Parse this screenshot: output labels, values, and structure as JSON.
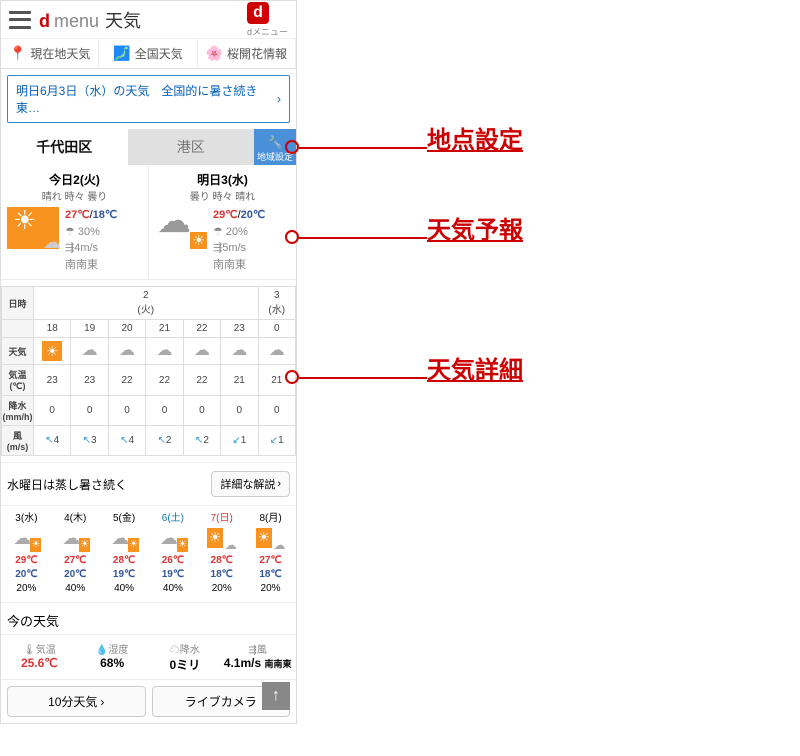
{
  "header": {
    "logo_d": "d",
    "logo_menu": "menu",
    "logo_weather": "天気",
    "badge_d": "d",
    "badge_label": "dメニュー"
  },
  "nav": {
    "current": "現在地天気",
    "national": "全国天気",
    "sakura": "桜開花情報"
  },
  "banner": "明日6月3日（水）の天気　全国的に暑さ続き東…",
  "loc": {
    "tab1": "千代田区",
    "tab2": "港区",
    "setting": "地域設定"
  },
  "today": {
    "title": "今日2(火)",
    "desc": "晴れ 時々 曇り",
    "hi": "27℃",
    "lo": "18℃",
    "pop": "30%",
    "wind": "4m/s",
    "dir": "南南東"
  },
  "tomorrow": {
    "title": "明日3(水)",
    "desc": "曇り 時々 晴れ",
    "hi": "29℃",
    "lo": "20℃",
    "pop": "20%",
    "wind": "5m/s",
    "dir": "南南東"
  },
  "hourly": {
    "rowlabels": {
      "time": "日時",
      "weather": "天気",
      "temp": "気温\n(℃)",
      "rain": "降水\n(mm/h)",
      "wind": "風\n(m/s)"
    },
    "dates": [
      "2\n(火)",
      "",
      "",
      "",
      "",
      "3\n(水)"
    ],
    "hours": [
      "18",
      "19",
      "20",
      "21",
      "22",
      "23",
      "0"
    ],
    "temps": [
      "23",
      "23",
      "22",
      "22",
      "22",
      "21",
      "21"
    ],
    "rain": [
      "0",
      "0",
      "0",
      "0",
      "0",
      "0",
      "0"
    ],
    "wind": [
      "4",
      "3",
      "4",
      "2",
      "2",
      "1",
      "1"
    ]
  },
  "summary": "水曜日は蒸し暑さ続く",
  "detail_btn": "詳細な解説",
  "week": [
    {
      "d": "3(水)",
      "cls": "",
      "ic": "cloud-sun",
      "hi": "29℃",
      "lo": "20℃",
      "pop": "20%"
    },
    {
      "d": "4(木)",
      "cls": "",
      "ic": "cloud-sun",
      "hi": "27℃",
      "lo": "20℃",
      "pop": "40%"
    },
    {
      "d": "5(金)",
      "cls": "",
      "ic": "cloud-sun",
      "hi": "28℃",
      "lo": "19℃",
      "pop": "40%"
    },
    {
      "d": "6(土)",
      "cls": "sat",
      "ic": "cloud-sun",
      "hi": "26℃",
      "lo": "19℃",
      "pop": "40%"
    },
    {
      "d": "7(日)",
      "cls": "sun",
      "ic": "sun-cloud",
      "hi": "28℃",
      "lo": "18℃",
      "pop": "20%"
    },
    {
      "d": "8(月)",
      "cls": "",
      "ic": "sun-cloud",
      "hi": "27℃",
      "lo": "18℃",
      "pop": "20%"
    }
  ],
  "now": {
    "title": "今の天気",
    "temp_label": "気温",
    "temp": "25.6℃",
    "hum_label": "湿度",
    "hum": "68%",
    "rain_label": "降水",
    "rain": "0ミリ",
    "wind_label": "風",
    "wind": "4.1m/s",
    "dir": "南南東"
  },
  "btns": {
    "tenmin": "10分天気",
    "live": "ライブカメラ"
  },
  "ann": {
    "a1": "地点設定",
    "a2": "天気予報",
    "a3": "天気詳細"
  }
}
